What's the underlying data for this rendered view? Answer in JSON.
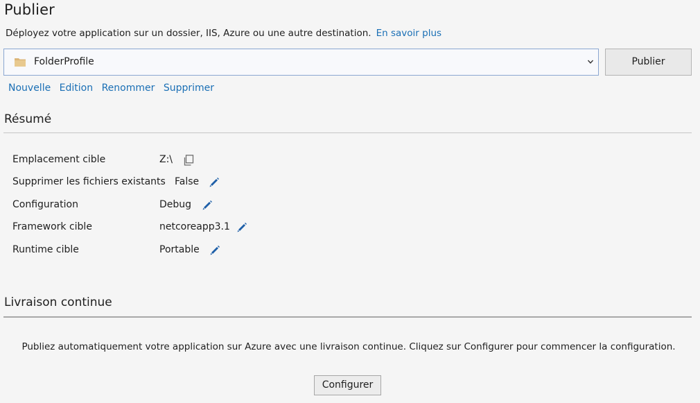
{
  "header": {
    "title": "Publier",
    "description": "Déployez votre application sur un dossier, IIS, Azure ou une autre destination.",
    "learn_more": "En savoir plus"
  },
  "profile": {
    "selected": "FolderProfile",
    "icon": "folder-icon",
    "publish_label": "Publier"
  },
  "actions": {
    "new": "Nouvelle",
    "edit": "Edition",
    "rename": "Renommer",
    "delete": "Supprimer"
  },
  "summary": {
    "title": "Résumé",
    "rows": [
      {
        "label": "Emplacement cible",
        "value": "Z:\\",
        "icon": "copy-icon"
      },
      {
        "label": "Supprimer les fichiers existants",
        "value": "False",
        "icon": "edit-pencil-icon"
      },
      {
        "label": "Configuration",
        "value": "Debug",
        "icon": "edit-pencil-icon"
      },
      {
        "label": "Framework cible",
        "value": "netcoreapp3.1",
        "icon": "edit-pencil-icon"
      },
      {
        "label": "Runtime cible",
        "value": "Portable",
        "icon": "edit-pencil-icon"
      }
    ]
  },
  "continuous_delivery": {
    "title": "Livraison continue",
    "description": "Publiez automatiquement votre application sur Azure avec une livraison continue. Cliquez sur Configurer pour commencer la configuration.",
    "configure_label": "Configurer"
  },
  "colors": {
    "link": "#1a6fb5",
    "pencil": "#1e5fa8",
    "folder": "#dcb67a"
  }
}
